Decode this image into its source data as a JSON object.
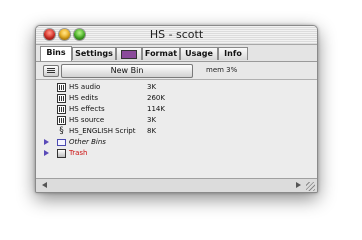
{
  "window": {
    "title": "HS - scott"
  },
  "tabs": [
    {
      "label": "Bins"
    },
    {
      "label": "Settings"
    },
    {
      "label": ""
    },
    {
      "label": "Format"
    },
    {
      "label": "Usage"
    },
    {
      "label": "Info"
    }
  ],
  "toolbar": {
    "new_bin_label": "New Bin",
    "memory_label": "mem 3%"
  },
  "items": [
    {
      "name": "HS audio",
      "size": "3K",
      "icon": "clip-icon",
      "expandable": false
    },
    {
      "name": "HS edits",
      "size": "260K",
      "icon": "clip-icon",
      "expandable": false
    },
    {
      "name": "HS effects",
      "size": "114K",
      "icon": "clip-icon",
      "expandable": false
    },
    {
      "name": "HS source",
      "size": "3K",
      "icon": "clip-icon",
      "expandable": false
    },
    {
      "name": "HS_ENGLISH Script",
      "size": "8K",
      "icon": "script-icon",
      "expandable": false
    },
    {
      "name": "Other Bins",
      "size": "",
      "icon": "folder-icon",
      "expandable": true
    },
    {
      "name": "Trash",
      "size": "",
      "icon": "trash-icon",
      "expandable": true
    }
  ],
  "colors": {
    "trash_text": "#cc1111",
    "disclosure": "#5a4ab8",
    "tab_icon": "#8a4a9a"
  }
}
